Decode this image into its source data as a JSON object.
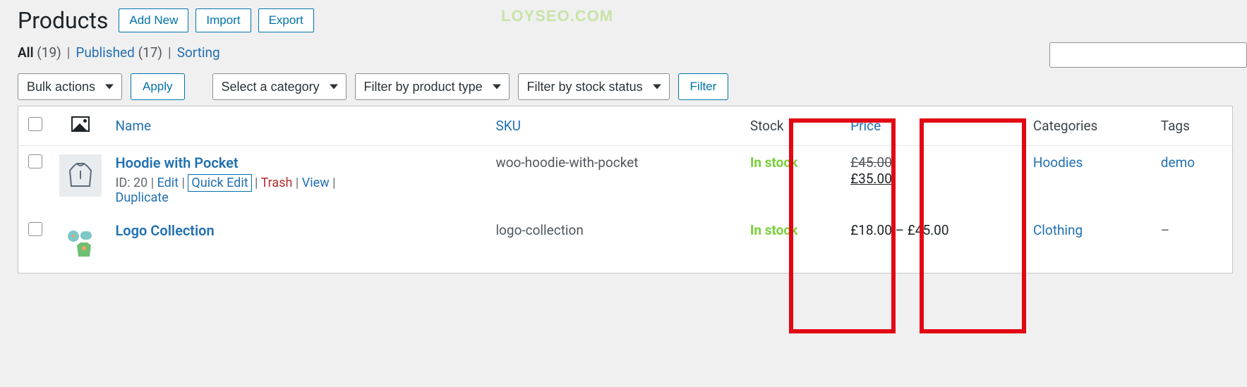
{
  "header": {
    "title": "Products",
    "add_new": "Add New",
    "import": "Import",
    "export": "Export",
    "watermark": "LOYSEO.COM"
  },
  "filters": {
    "all_label": "All",
    "all_count": "(19)",
    "published_label": "Published",
    "published_count": "(17)",
    "sorting": "Sorting",
    "sep": "|"
  },
  "tablenav": {
    "bulk": "Bulk actions",
    "apply": "Apply",
    "cat": "Select a category",
    "type": "Filter by product type",
    "stock": "Filter by stock status",
    "filter": "Filter"
  },
  "columns": {
    "name": "Name",
    "sku": "SKU",
    "stock": "Stock",
    "price": "Price",
    "categories": "Categories",
    "tags": "Tags"
  },
  "rows": [
    {
      "title": "Hoodie with Pocket",
      "id_label": "ID: 20",
      "actions": {
        "edit": "Edit",
        "quick_edit": "Quick Edit",
        "trash": "Trash",
        "view": "View",
        "duplicate": "Duplicate"
      },
      "sku": "woo-hoodie-with-pocket",
      "stock": "In stock",
      "price_old": "£45.00",
      "price_new": "£35.00",
      "category": "Hoodies",
      "tag": "demo"
    },
    {
      "title": "Logo Collection",
      "sku": "logo-collection",
      "stock": "In stock",
      "price_range": "£18.00 – £45.00",
      "category": "Clothing",
      "tag": "–"
    }
  ],
  "sep": " | "
}
